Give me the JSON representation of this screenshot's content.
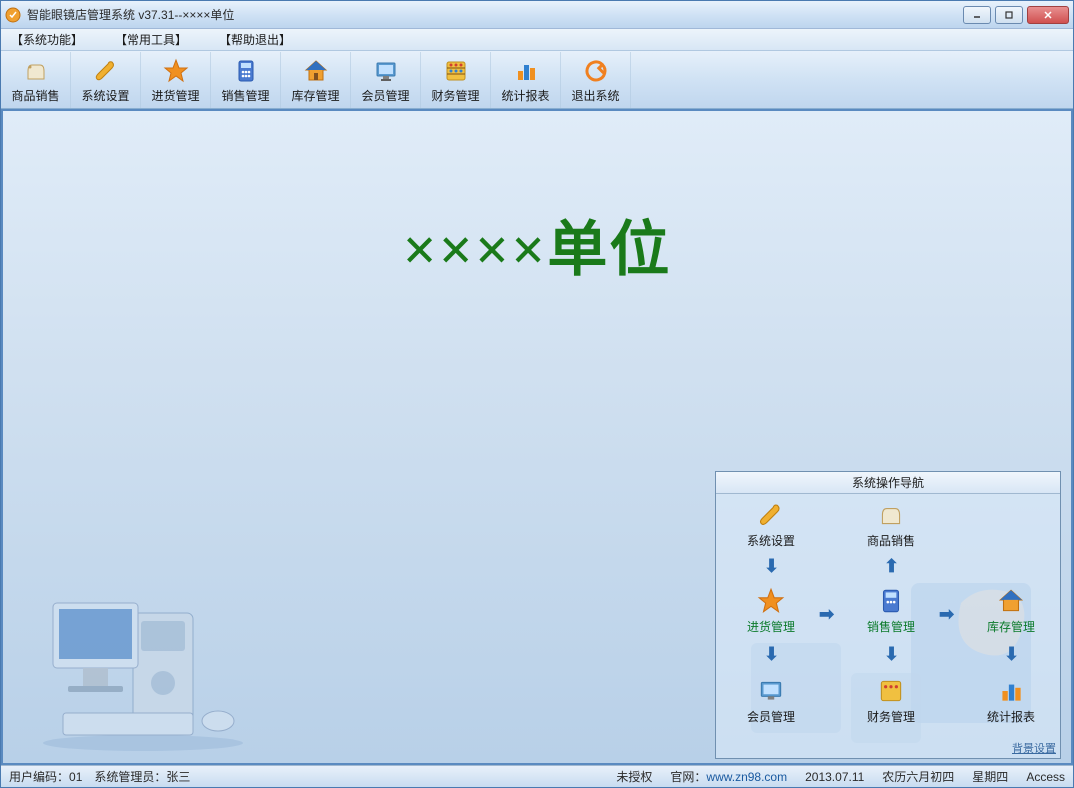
{
  "title": "智能眼镜店管理系统 v37.31--××××单位",
  "menu": {
    "m1": "【系统功能】",
    "m2": "【常用工具】",
    "m3": "【帮助退出】"
  },
  "toolbar": {
    "t1": "商品销售",
    "t2": "系统设置",
    "t3": "进货管理",
    "t4": "销售管理",
    "t5": "库存管理",
    "t6": "会员管理",
    "t7": "财务管理",
    "t8": "统计报表",
    "t9": "退出系统"
  },
  "main": {
    "company": "××××单位",
    "nav_title": "系统操作导航",
    "nav": {
      "settings": "系统设置",
      "sales": "商品销售",
      "purchase": "进货管理",
      "sell_mgmt": "销售管理",
      "stock": "库存管理",
      "member": "会员管理",
      "finance": "财务管理",
      "report": "统计报表"
    },
    "bg_setting": "背景设置"
  },
  "status": {
    "user_code_label": "用户编码：",
    "user_code": "01",
    "admin_label": "系统管理员：",
    "admin": "张三",
    "auth": "未授权",
    "site_label": "官网：",
    "site": "www.zn98.com",
    "date": "2013.07.11",
    "lunar": "农历六月初四",
    "weekday": "星期四",
    "db": "Access"
  }
}
